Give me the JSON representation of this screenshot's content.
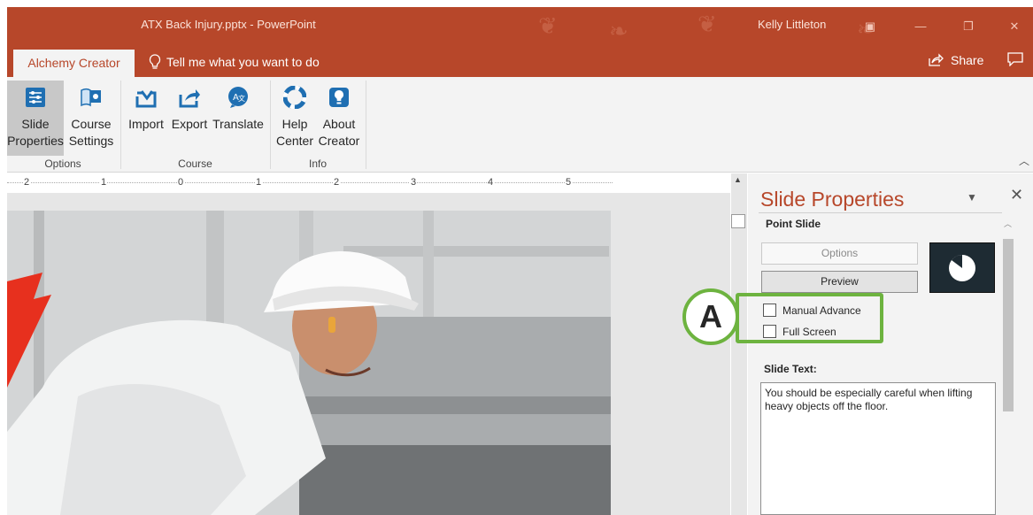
{
  "window": {
    "title": "ATX Back Injury.pptx  -  PowerPoint",
    "user": "Kelly Littleton"
  },
  "tabs": {
    "active": "Alchemy Creator",
    "tell_me": "Tell me what you want to do",
    "share": "Share"
  },
  "ribbon": {
    "buttons": [
      {
        "line1": "Slide",
        "line2": "Properties",
        "icon": "slide-properties-icon"
      },
      {
        "line1": "Course",
        "line2": "Settings",
        "icon": "course-settings-icon"
      },
      {
        "line1": "Import",
        "line2": "",
        "icon": "import-icon"
      },
      {
        "line1": "Export",
        "line2": "",
        "icon": "export-icon"
      },
      {
        "line1": "Translate",
        "line2": "",
        "icon": "translate-icon"
      },
      {
        "line1": "Help",
        "line2": "Center",
        "icon": "help-center-icon"
      },
      {
        "line1": "About",
        "line2": "Creator",
        "icon": "about-creator-icon"
      }
    ],
    "groups": [
      "Options",
      "Course",
      "Info"
    ]
  },
  "ruler": {
    "labels": [
      "2",
      "1",
      "0",
      "1",
      "2",
      "3",
      "4",
      "5"
    ]
  },
  "pane": {
    "title": "Slide Properties",
    "section": "Point Slide",
    "options_label": "Options",
    "preview_label": "Preview",
    "manual_advance_label": "Manual Advance",
    "full_screen_label": "Full Screen",
    "slide_text_label": "Slide Text:",
    "slide_text_value": "You should be especially careful when lifting heavy objects off the floor."
  },
  "annotation": {
    "label": "A",
    "color": "#6db33f"
  },
  "colors": {
    "accent": "#b7472a",
    "ribbon_bg": "#f3f3f3"
  }
}
